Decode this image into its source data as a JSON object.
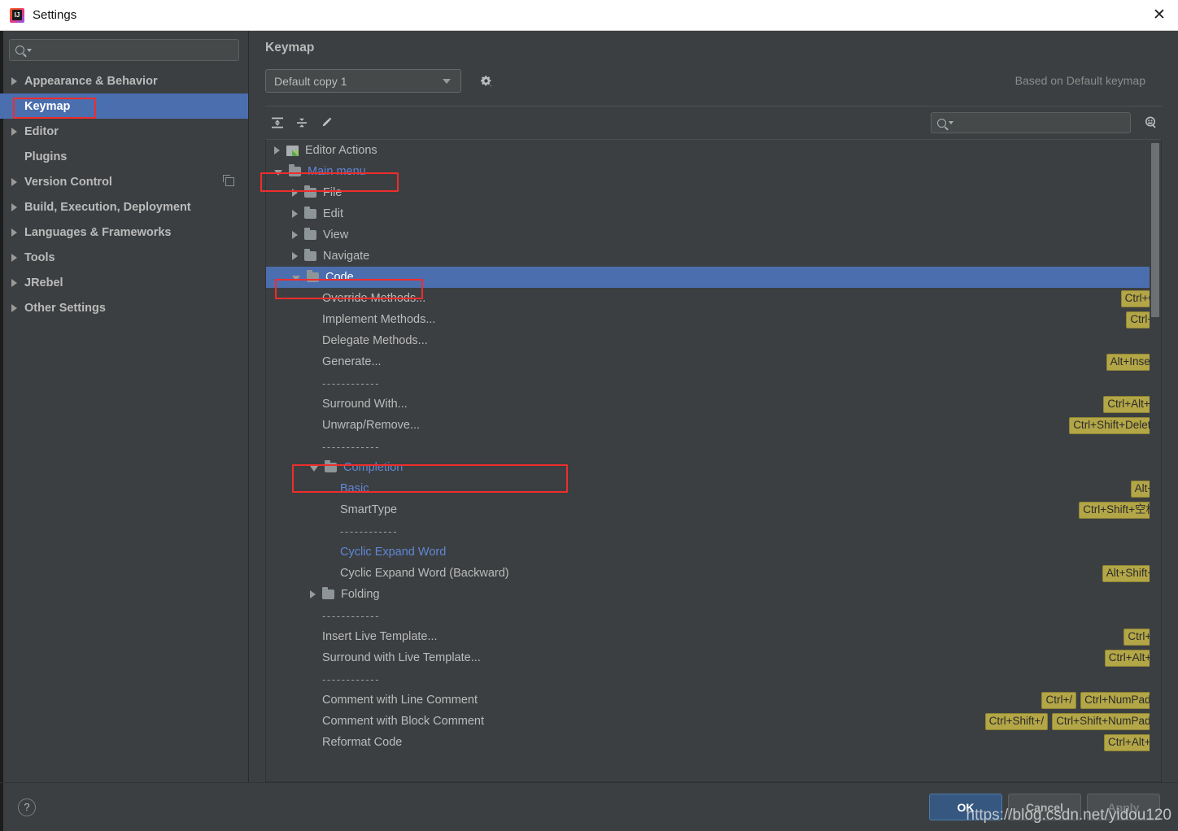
{
  "window": {
    "title": "Settings",
    "app_icon": "intellij-idea-icon",
    "close_label": "✕"
  },
  "sidebar": {
    "search": {
      "placeholder": "",
      "value": "",
      "icon": "search-icon"
    },
    "items": [
      {
        "label": "Appearance & Behavior",
        "arrow": true,
        "selected": false,
        "badge": false
      },
      {
        "label": "Keymap",
        "arrow": false,
        "selected": true,
        "badge": false
      },
      {
        "label": "Editor",
        "arrow": true,
        "selected": false,
        "badge": false
      },
      {
        "label": "Plugins",
        "arrow": false,
        "selected": false,
        "badge": false
      },
      {
        "label": "Version Control",
        "arrow": true,
        "selected": false,
        "badge": true
      },
      {
        "label": "Build, Execution, Deployment",
        "arrow": true,
        "selected": false,
        "badge": false
      },
      {
        "label": "Languages & Frameworks",
        "arrow": true,
        "selected": false,
        "badge": false
      },
      {
        "label": "Tools",
        "arrow": true,
        "selected": false,
        "badge": false
      },
      {
        "label": "JRebel",
        "arrow": true,
        "selected": false,
        "badge": false
      },
      {
        "label": "Other Settings",
        "arrow": true,
        "selected": false,
        "badge": false
      }
    ]
  },
  "main": {
    "page_title": "Keymap",
    "keymap_select": {
      "value": "Default copy 1",
      "icon": "chevron-down-icon"
    },
    "gear_icon": "gear-icon",
    "based_on": "Based on Default keymap",
    "toolbar": {
      "expand_all_icon": "expand-all-icon",
      "collapse_all_icon": "collapse-all-icon",
      "edit_icon": "pencil-edit-icon",
      "find_placeholder": "",
      "find_value": "",
      "find_icon": "search-icon",
      "find_by_shortcut_icon": "find-by-shortcut-icon"
    }
  },
  "tree": {
    "rows": [
      {
        "indent": 0,
        "arrow": "closed",
        "icon": "editor",
        "label": "Editor Actions",
        "modified": false,
        "selected": false,
        "shortcuts": []
      },
      {
        "indent": 0,
        "arrow": "open",
        "icon": "folder-menu",
        "label": "Main menu",
        "modified": true,
        "selected": false,
        "shortcuts": [],
        "highlight": true
      },
      {
        "indent": 1,
        "arrow": "closed",
        "icon": "folder",
        "label": "File",
        "modified": false,
        "selected": false,
        "shortcuts": []
      },
      {
        "indent": 1,
        "arrow": "closed",
        "icon": "folder",
        "label": "Edit",
        "modified": false,
        "selected": false,
        "shortcuts": []
      },
      {
        "indent": 1,
        "arrow": "closed",
        "icon": "folder",
        "label": "View",
        "modified": false,
        "selected": false,
        "shortcuts": []
      },
      {
        "indent": 1,
        "arrow": "closed",
        "icon": "folder",
        "label": "Navigate",
        "modified": false,
        "selected": false,
        "shortcuts": []
      },
      {
        "indent": 1,
        "arrow": "open",
        "icon": "folder",
        "label": "Code",
        "modified": false,
        "selected": true,
        "shortcuts": [],
        "highlight": true
      },
      {
        "indent": 2,
        "arrow": "none",
        "icon": "none",
        "label": "Override Methods...",
        "modified": false,
        "selected": false,
        "shortcuts": [
          "Ctrl+O"
        ]
      },
      {
        "indent": 2,
        "arrow": "none",
        "icon": "none",
        "label": "Implement Methods...",
        "modified": false,
        "selected": false,
        "shortcuts": [
          "Ctrl+I"
        ]
      },
      {
        "indent": 2,
        "arrow": "none",
        "icon": "none",
        "label": "Delegate Methods...",
        "modified": false,
        "selected": false,
        "shortcuts": []
      },
      {
        "indent": 2,
        "arrow": "none",
        "icon": "none",
        "label": "Generate...",
        "modified": false,
        "selected": false,
        "shortcuts": [
          "Alt+Insert"
        ]
      },
      {
        "indent": 2,
        "arrow": "none",
        "icon": "none",
        "label": "------------",
        "separator": true,
        "modified": false,
        "selected": false,
        "shortcuts": []
      },
      {
        "indent": 2,
        "arrow": "none",
        "icon": "none",
        "label": "Surround With...",
        "modified": false,
        "selected": false,
        "shortcuts": [
          "Ctrl+Alt+T"
        ]
      },
      {
        "indent": 2,
        "arrow": "none",
        "icon": "none",
        "label": "Unwrap/Remove...",
        "modified": false,
        "selected": false,
        "shortcuts": [
          "Ctrl+Shift+Delete"
        ]
      },
      {
        "indent": 2,
        "arrow": "none",
        "icon": "none",
        "label": "------------",
        "separator": true,
        "modified": false,
        "selected": false,
        "shortcuts": []
      },
      {
        "indent": 2,
        "arrow": "open",
        "icon": "folder",
        "label": "Completion",
        "modified": true,
        "selected": false,
        "shortcuts": [],
        "highlight": true
      },
      {
        "indent": 3,
        "arrow": "none",
        "icon": "none",
        "label": "Basic",
        "modified": true,
        "selected": false,
        "shortcuts": [
          "Alt+/"
        ]
      },
      {
        "indent": 3,
        "arrow": "none",
        "icon": "none",
        "label": "SmartType",
        "modified": false,
        "selected": false,
        "shortcuts": [
          "Ctrl+Shift+空格"
        ]
      },
      {
        "indent": 3,
        "arrow": "none",
        "icon": "none",
        "label": "------------",
        "separator": true,
        "modified": false,
        "selected": false,
        "shortcuts": []
      },
      {
        "indent": 3,
        "arrow": "none",
        "icon": "none",
        "label": "Cyclic Expand Word",
        "modified": true,
        "selected": false,
        "shortcuts": []
      },
      {
        "indent": 3,
        "arrow": "none",
        "icon": "none",
        "label": "Cyclic Expand Word (Backward)",
        "modified": false,
        "selected": false,
        "shortcuts": [
          "Alt+Shift+/"
        ]
      },
      {
        "indent": 2,
        "arrow": "closed",
        "icon": "folder",
        "label": "Folding",
        "modified": false,
        "selected": false,
        "shortcuts": []
      },
      {
        "indent": 2,
        "arrow": "none",
        "icon": "none",
        "label": "------------",
        "separator": true,
        "modified": false,
        "selected": false,
        "shortcuts": []
      },
      {
        "indent": 2,
        "arrow": "none",
        "icon": "none",
        "label": "Insert Live Template...",
        "modified": false,
        "selected": false,
        "shortcuts": [
          "Ctrl+J"
        ]
      },
      {
        "indent": 2,
        "arrow": "none",
        "icon": "none",
        "label": "Surround with Live Template...",
        "modified": false,
        "selected": false,
        "shortcuts": [
          "Ctrl+Alt+J"
        ]
      },
      {
        "indent": 2,
        "arrow": "none",
        "icon": "none",
        "label": "------------",
        "separator": true,
        "modified": false,
        "selected": false,
        "shortcuts": []
      },
      {
        "indent": 2,
        "arrow": "none",
        "icon": "none",
        "label": "Comment with Line Comment",
        "modified": false,
        "selected": false,
        "shortcuts": [
          "Ctrl+/",
          "Ctrl+NumPad /"
        ]
      },
      {
        "indent": 2,
        "arrow": "none",
        "icon": "none",
        "label": "Comment with Block Comment",
        "modified": false,
        "selected": false,
        "shortcuts": [
          "Ctrl+Shift+/",
          "Ctrl+Shift+NumPad /"
        ]
      },
      {
        "indent": 2,
        "arrow": "none",
        "icon": "none",
        "label": "Reformat Code",
        "modified": false,
        "selected": false,
        "shortcuts": [
          "Ctrl+Alt+L"
        ]
      }
    ]
  },
  "footer": {
    "help_label": "?",
    "ok_label": "OK",
    "cancel_label": "Cancel",
    "apply_label": "Apply",
    "watermark": "https://blog.csdn.net/yidou120"
  },
  "colors": {
    "selection_blue": "#4b6eaf",
    "modified_blue": "#5f87d6",
    "shortcut_badge": "#b3a647",
    "highlight_red": "#ef2d2d",
    "panel_bg": "#3c3f41",
    "primary_button": "#365880"
  }
}
